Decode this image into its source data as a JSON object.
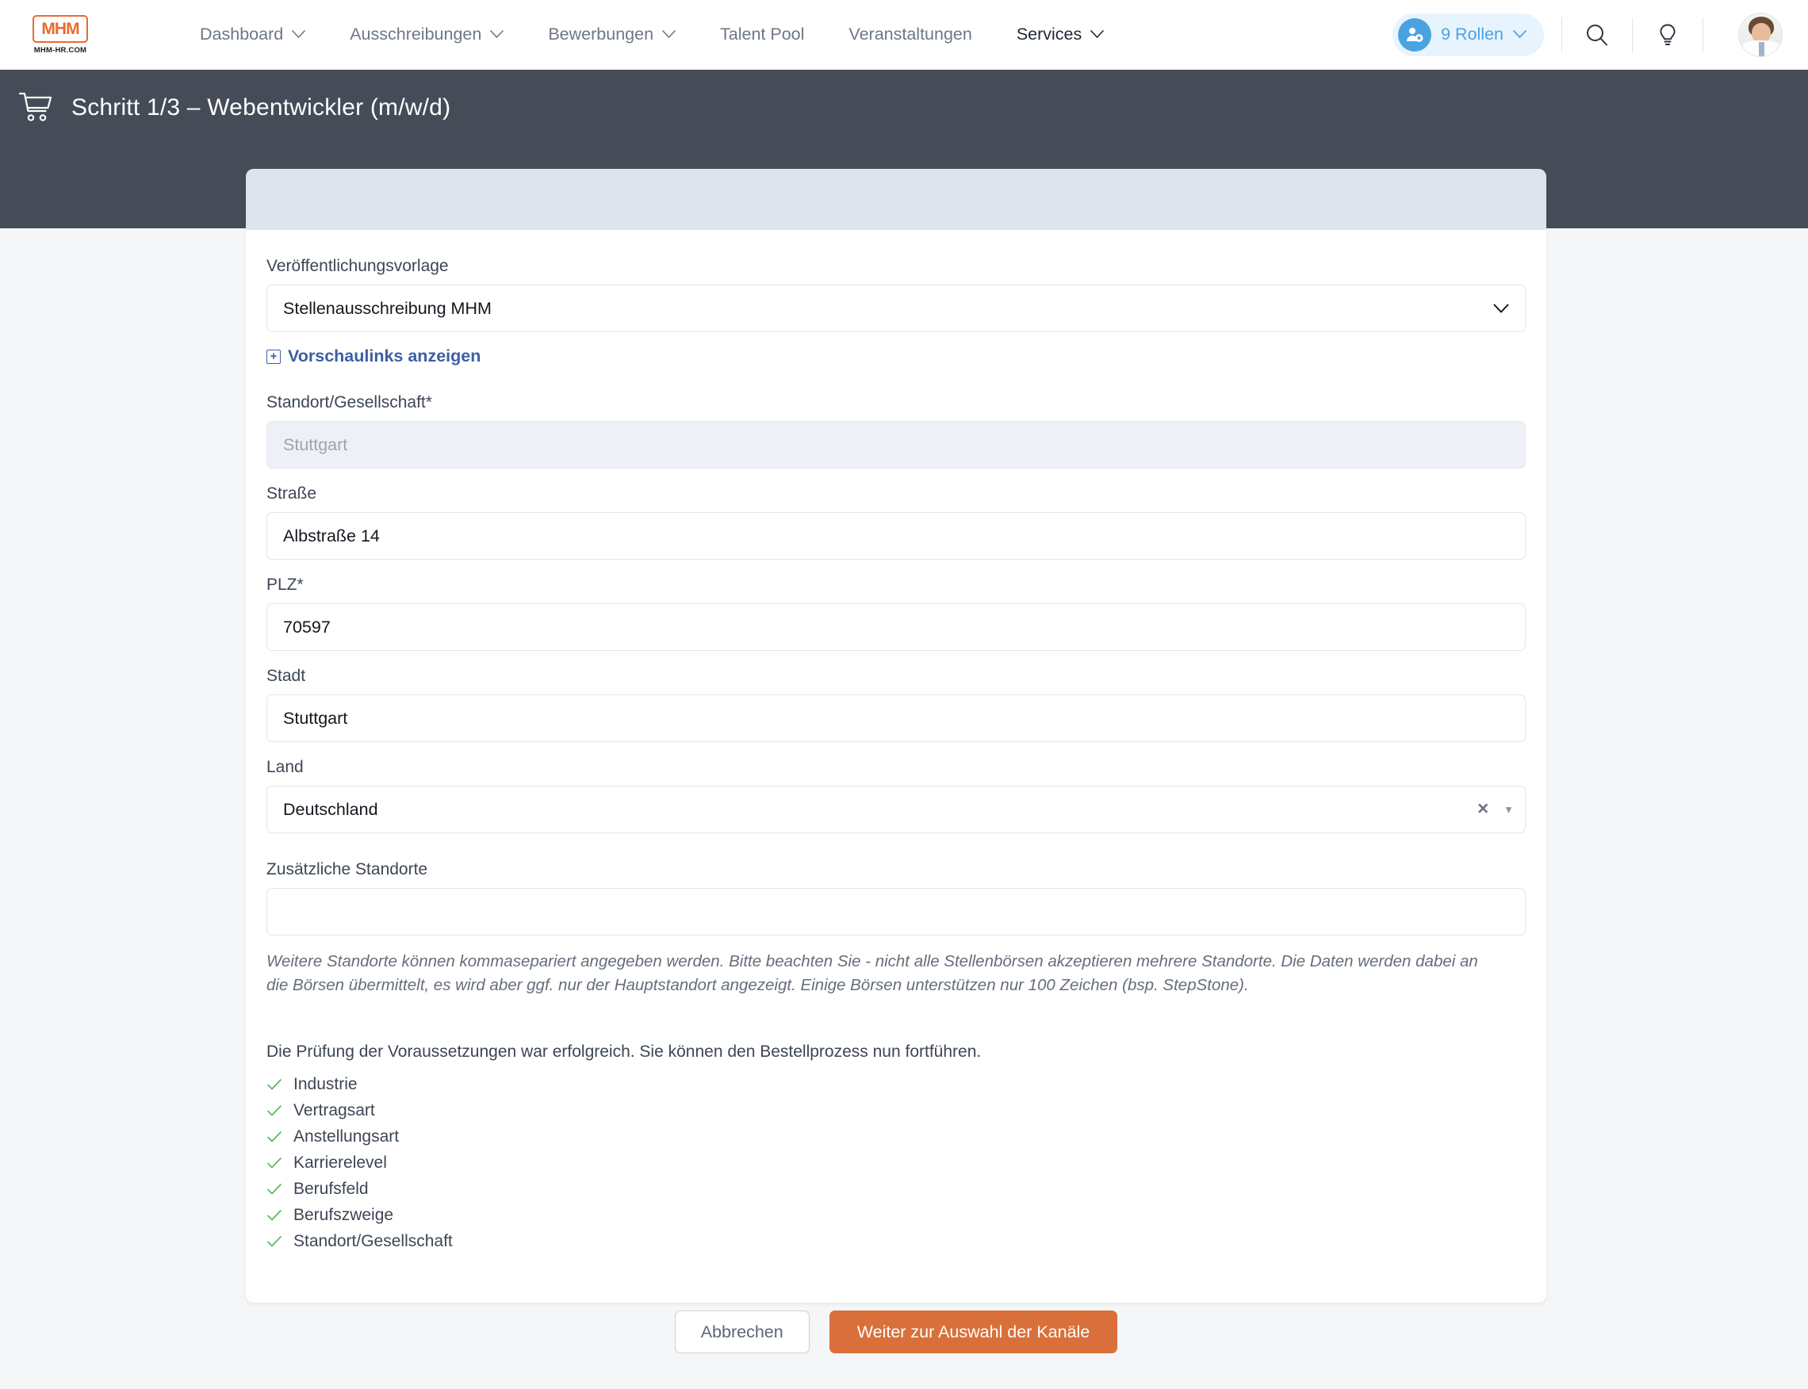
{
  "topnav": {
    "logo": {
      "mark": "MHM",
      "caption": "MHM-HR.COM"
    },
    "items": [
      {
        "label": "Dashboard",
        "has_chevron": true,
        "active": false
      },
      {
        "label": "Ausschreibungen",
        "has_chevron": true,
        "active": false
      },
      {
        "label": "Bewerbungen",
        "has_chevron": true,
        "active": false
      },
      {
        "label": "Talent Pool",
        "has_chevron": false,
        "active": false
      },
      {
        "label": "Veranstaltungen",
        "has_chevron": false,
        "active": false
      },
      {
        "label": "Services",
        "has_chevron": true,
        "active": true
      }
    ],
    "roles_pill": {
      "label": "9 Rollen",
      "icon": "user-gear-icon",
      "color": "#4aa3e0",
      "background": "#e8f4fd"
    },
    "icons": {
      "search": "search-icon",
      "tips": "lightbulb-icon",
      "avatar": "user-avatar"
    }
  },
  "stepbar": {
    "icon": "shopping-cart-icon",
    "title": "Schritt 1/3 – Webentwickler (m/w/d)",
    "background": "#454c57"
  },
  "form": {
    "template": {
      "label": "Veröffentlichungsvorlage",
      "value": "Stellenausschreibung MHM",
      "control": "select"
    },
    "preview_link": {
      "label": "Vorschaulinks anzeigen",
      "icon": "plus-box-icon",
      "color": "#3c5fa4"
    },
    "location_company": {
      "label": "Standort/Gesellschaft*",
      "value": "Stuttgart",
      "disabled": true
    },
    "street": {
      "label": "Straße",
      "value": "Albstraße 14"
    },
    "zip": {
      "label": "PLZ*",
      "value": "70597"
    },
    "city": {
      "label": "Stadt",
      "value": "Stuttgart"
    },
    "country": {
      "label": "Land",
      "value": "Deutschland",
      "clear_icon": "✕",
      "arrow_icon": "▼"
    },
    "additional_locations": {
      "label": "Zusätzliche Standorte",
      "value": "",
      "placeholder": ""
    },
    "help_text": "Weitere Standorte können kommasepariert angegeben werden. Bitte beachten Sie - nicht alle Stellenbörsen akzeptieren mehrere Standorte. Die Daten werden dabei an die Börsen übermittelt, es wird aber ggf. nur der Hauptstandort angezeigt. Einige Börsen unterstützen nur 100 Zeichen (bsp. StepStone)."
  },
  "validation": {
    "intro": "Die Prüfung der Voraussetzungen war erfolgreich. Sie können den Bestellprozess nun fortführen.",
    "check_color": "#5cb85c",
    "items": [
      {
        "label": "Industrie"
      },
      {
        "label": "Vertragsart"
      },
      {
        "label": "Anstellungsart"
      },
      {
        "label": "Karrierelevel"
      },
      {
        "label": "Berufsfeld"
      },
      {
        "label": "Berufszweige"
      },
      {
        "label": "Standort/Gesellschaft"
      }
    ]
  },
  "actions": {
    "cancel": "Abbrechen",
    "next": "Weiter zur Auswahl der Kanäle",
    "next_color": "#d9703b"
  }
}
